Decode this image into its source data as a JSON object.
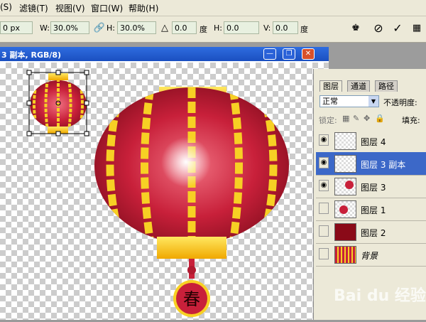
{
  "menubar": {
    "items": [
      "(S)",
      "滤镜(T)",
      "视图(V)",
      "窗口(W)",
      "帮助(H)"
    ]
  },
  "options": {
    "x_value": "0 px",
    "w_label": "W:",
    "w_value": "30.0%",
    "h_label": "H:",
    "h_value": "30.0%",
    "angle_value": "0.0",
    "deg1": "度",
    "hskew_label": "H:",
    "hskew_value": "0.0",
    "deg2": "度",
    "v_label": "V:",
    "v_value": "0.0",
    "deg3": "度"
  },
  "document": {
    "title": "3 副本, RGB/8)",
    "seal_char": "春"
  },
  "layers_panel": {
    "tabs": [
      "图层",
      "通道",
      "路径"
    ],
    "blend_mode": "正常",
    "opacity_label": "不透明度:",
    "lock_label": "锁定:",
    "fill_label": "填充:",
    "layers": [
      {
        "name": "图层 4",
        "visible": true,
        "selected": false
      },
      {
        "name": "图层 3 副本",
        "visible": true,
        "selected": true
      },
      {
        "name": "图层 3",
        "visible": true,
        "selected": false
      },
      {
        "name": "图层 1",
        "visible": false,
        "selected": false
      },
      {
        "name": "图层 2",
        "visible": false,
        "selected": false
      },
      {
        "name": "背景",
        "visible": false,
        "selected": false
      }
    ]
  },
  "watermark": "Bai du 经验",
  "colors": {
    "lantern_red": "#c8203a",
    "lantern_yellow": "#f7d024",
    "selection_blue": "#3c68c8"
  }
}
